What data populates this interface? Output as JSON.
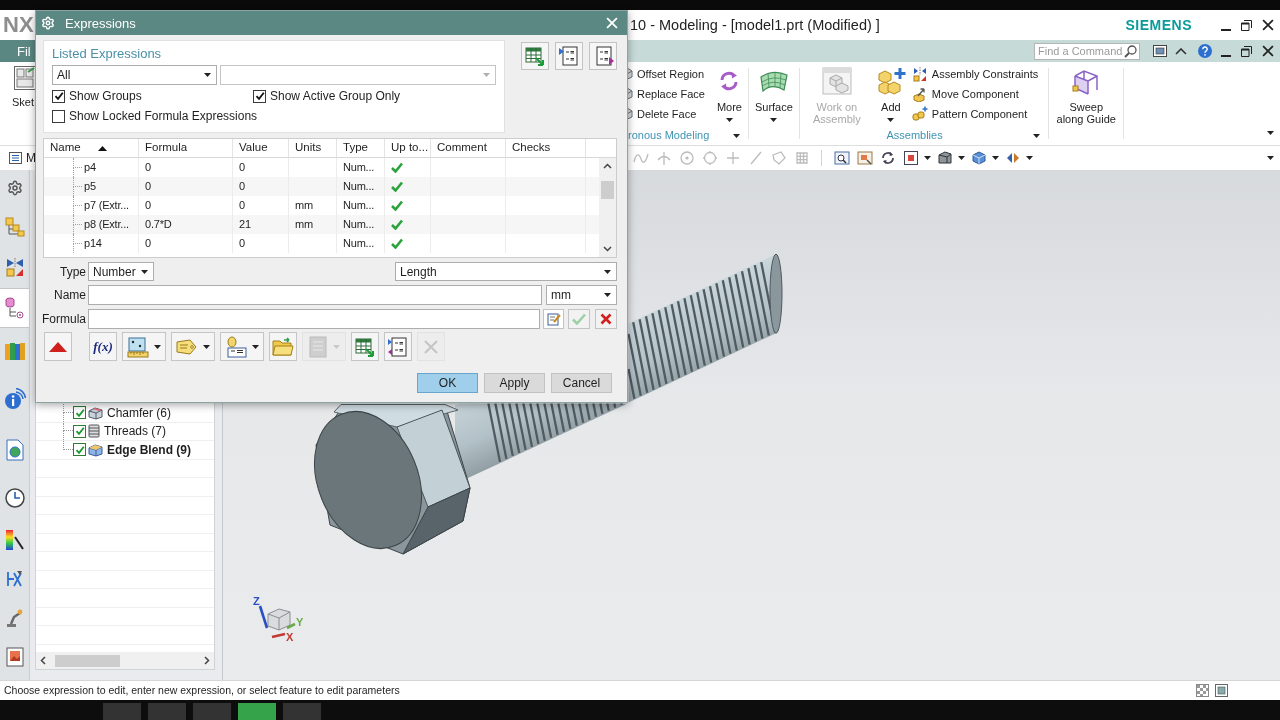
{
  "app_window": {
    "logo": "NX",
    "title": "10 - Modeling - [model1.prt (Modified) ]",
    "brand": "SIEMENS"
  },
  "ribbon_tabs": {
    "file_tab": "Fil",
    "search": {
      "placeholder": "Find a Command"
    }
  },
  "ribbon": {
    "left_command": "Sket",
    "groups": [
      {
        "label": "ronous Modeling",
        "commands": [
          {
            "kind": "small",
            "label": "Offset Region",
            "disabled": false
          },
          {
            "kind": "small",
            "label": "Replace Face",
            "disabled": false
          },
          {
            "kind": "small",
            "label": "Delete Face",
            "disabled": false
          },
          {
            "kind": "large",
            "label": "More",
            "disabled": false,
            "dropdown": true
          }
        ]
      },
      {
        "commands": [
          {
            "kind": "large",
            "label": "Surface",
            "disabled": false,
            "dropdown": true
          }
        ]
      },
      {
        "label": "Assemblies",
        "commands": [
          {
            "kind": "large",
            "label": "Work on Assembly",
            "disabled": true,
            "dropdown": false
          },
          {
            "kind": "large",
            "label": "Add",
            "disabled": false,
            "dropdown": true
          },
          {
            "kind": "small",
            "label": "Assembly Constraints",
            "disabled": false
          },
          {
            "kind": "small",
            "label": "Move Component",
            "disabled": false
          },
          {
            "kind": "small",
            "label": "Pattern Component",
            "disabled": false
          }
        ]
      },
      {
        "commands": [
          {
            "kind": "large",
            "label": "Sweep along Guide",
            "disabled": false,
            "dropdown": false
          }
        ]
      }
    ]
  },
  "quick_toolbar": {
    "menu_label": "M",
    "tools": [
      {
        "disabled": true,
        "dropdown": false
      },
      {
        "disabled": true,
        "dropdown": false
      },
      {
        "disabled": true,
        "dropdown": false
      },
      {
        "disabled": true,
        "dropdown": false
      },
      {
        "disabled": true,
        "dropdown": false
      },
      {
        "disabled": true,
        "dropdown": false
      },
      {
        "disabled": true,
        "dropdown": false
      },
      {
        "disabled": true,
        "dropdown": false
      },
      {
        "disabled": false,
        "dropdown": false
      },
      {
        "disabled": false,
        "dropdown": false
      },
      {
        "disabled": false,
        "dropdown": false
      },
      {
        "disabled": false,
        "dropdown": true
      },
      {
        "disabled": false,
        "dropdown": true
      },
      {
        "disabled": false,
        "dropdown": true
      },
      {
        "disabled": false,
        "dropdown": true
      }
    ]
  },
  "resource_bar": [
    {
      "selected": false
    },
    {
      "selected": false
    },
    {
      "selected": false
    },
    {
      "selected": true
    },
    {
      "selected": false
    },
    {
      "selected": false
    },
    {
      "selected": false
    },
    {
      "selected": false
    },
    {
      "selected": false
    },
    {
      "selected": false
    },
    {
      "selected": false
    },
    {
      "selected": false
    }
  ],
  "part_navigator": {
    "rows": [
      {
        "label": "Chamfer (6)",
        "checked": true,
        "current": false
      },
      {
        "label": "Threads (7)",
        "checked": true,
        "current": false
      },
      {
        "label": "Edge Blend (9)",
        "checked": true,
        "current": true
      }
    ]
  },
  "viewport": {
    "triad_axes": [
      {
        "label": "Z",
        "color": "#2a4fc4"
      },
      {
        "label": "Y",
        "color": "#6aaa4c"
      },
      {
        "label": "X",
        "color": "#c23a34"
      }
    ]
  },
  "status_bar": {
    "message": "Choose expression to edit, enter new expression, or select feature to edit parameters"
  },
  "taskbar": [
    {
      "selected": false
    },
    {
      "selected": false
    },
    {
      "selected": false
    },
    {
      "selected": true
    },
    {
      "selected": false
    }
  ],
  "dialog": {
    "title": "Expressions",
    "listed_expressions": {
      "title": "Listed Expressions",
      "filter": "All",
      "options": [
        {
          "label": "Show Groups",
          "checked": true
        },
        {
          "label": "Show Active Group Only",
          "checked": true
        },
        {
          "label": "Show Locked Formula Expressions",
          "checked": false
        }
      ]
    },
    "table": {
      "columns": [
        {
          "label": "Name",
          "sorted": true
        },
        {
          "label": "Formula",
          "sorted": false
        },
        {
          "label": "Value",
          "sorted": false
        },
        {
          "label": "Units",
          "sorted": false
        },
        {
          "label": "Type",
          "sorted": false
        },
        {
          "label": "Up to...",
          "sorted": false
        },
        {
          "label": "Comment",
          "sorted": false
        },
        {
          "label": "Checks",
          "sorted": false
        }
      ],
      "rows": [
        {
          "name": "p4",
          "formula": "0",
          "value": "0",
          "type": "Num...",
          "up_to_date": true
        },
        {
          "name": "p5",
          "formula": "0",
          "value": "0",
          "type": "Num...",
          "up_to_date": true
        },
        {
          "name": "p7 (Extr...",
          "formula": "0",
          "value": "0",
          "units": "mm",
          "type": "Num...",
          "up_to_date": true
        },
        {
          "name": "p8 (Extr...",
          "formula": "0.7*D",
          "value": "21",
          "units": "mm",
          "type": "Num...",
          "up_to_date": true
        },
        {
          "name": "p14",
          "formula": "0",
          "value": "0",
          "type": "Num...",
          "up_to_date": true
        }
      ]
    },
    "type_field": {
      "label": "Type",
      "value": "Number"
    },
    "dimension": {
      "value": "Length"
    },
    "name_field": {
      "label": "Name"
    },
    "units": {
      "value": "mm"
    },
    "formula_field": {
      "label": "Formula"
    },
    "formula_tools": [
      {
        "kind": "edit",
        "disabled": false
      },
      {
        "kind": "accept",
        "disabled": true
      },
      {
        "kind": "reject",
        "disabled": false
      }
    ],
    "tools": [
      {
        "kind": "icon",
        "dropdown": false,
        "disabled": false
      },
      {
        "kind": "text",
        "label": "f(x)",
        "dropdown": false,
        "disabled": false
      },
      {
        "kind": "icon",
        "dropdown": true,
        "disabled": false
      },
      {
        "kind": "icon",
        "dropdown": true,
        "disabled": false
      },
      {
        "kind": "icon",
        "dropdown": true,
        "disabled": false
      },
      {
        "kind": "icon",
        "dropdown": false,
        "disabled": false
      },
      {
        "kind": "icon",
        "dropdown": true,
        "disabled": true
      },
      {
        "kind": "icon",
        "dropdown": false,
        "disabled": false
      },
      {
        "kind": "icon",
        "dropdown": false,
        "disabled": false
      },
      {
        "kind": "icon",
        "dropdown": false,
        "disabled": true
      }
    ],
    "buttons": [
      {
        "label": "OK",
        "default": true
      },
      {
        "label": "Apply",
        "default": false
      },
      {
        "label": "Cancel",
        "default": false
      }
    ]
  }
}
